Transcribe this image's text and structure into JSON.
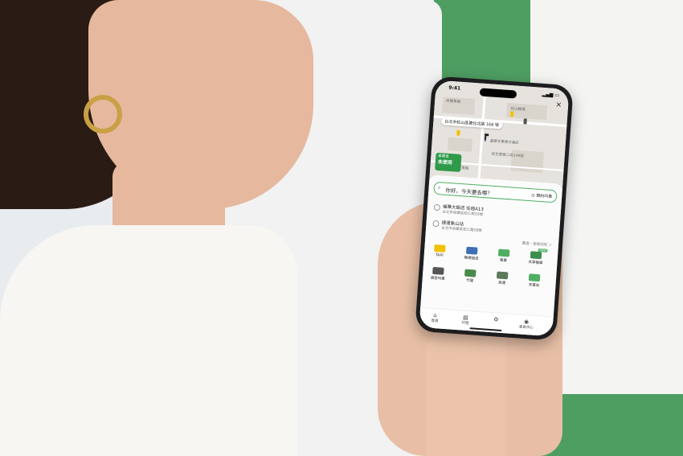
{
  "phone": {
    "status_time": "9:41",
    "map": {
      "labels": [
        "民權東路",
        "松山機場",
        "台北市松山區寶化北路 168 號",
        "晶華文華東方酒店",
        "民生東路二段149號",
        "民生東路"
      ],
      "pickup_address": "台北市松山區寶化北路 168 號"
    },
    "rider": {
      "label": "乘車身",
      "value": "未使用"
    },
    "search": {
      "placeholder": "你好，今天要去哪？",
      "book_label": "預約叫車"
    },
    "recent": [
      {
        "title": "福華大飯店 住宿A13",
        "subtitle": "台北市信義區松仁路58號"
      },
      {
        "title": "捷運象山站",
        "subtitle": "台北市信義區松仁路58號"
      }
    ],
    "more_label": "看過・查詢到到 ＞",
    "services": [
      {
        "label": "TAXI",
        "color": "#f2c200"
      },
      {
        "label": "機場接送",
        "color": "#3e6fb5"
      },
      {
        "label": "租車",
        "color": "#4fae63"
      },
      {
        "label": "共享機車",
        "color": "#3a8f4f",
        "badge": "NEW"
      },
      {
        "label": "語音叫車",
        "color": "#555555"
      },
      {
        "label": "代駕",
        "color": "#4a8a4a"
      },
      {
        "label": "貨運",
        "color": "#5a7a5a"
      },
      {
        "label": "充電站",
        "color": "#4fae63"
      }
    ],
    "nav": [
      "首頁",
      "行程",
      "",
      "會員中心"
    ]
  }
}
